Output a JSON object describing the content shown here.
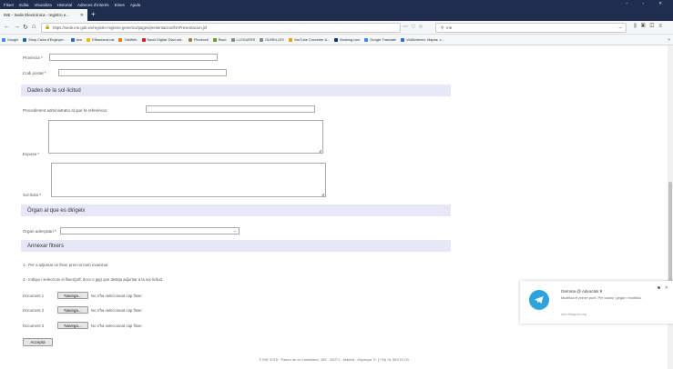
{
  "browser": {
    "menu": [
      "Fitxer",
      "Edita",
      "Visualitza",
      "Historial",
      "Adreces d'interès",
      "Eines",
      "Ajuda"
    ],
    "tab_title": "INE - Sede Electrónica - registro e...",
    "url": "https://sede.ine.gob.es/registro-registro-generico/pages/presentacion/frmPresentacion.jsf",
    "search_value": "ine",
    "bookmarks": [
      {
        "label": "Google",
        "color": "#4285f4"
      },
      {
        "label": "Shop Caixa d'Enginyer...",
        "color": "#1d5fa8"
      },
      {
        "label": "Ave",
        "color": "#1e6fb8"
      },
      {
        "label": "ElNacional.cat",
        "color": "#f2b600"
      },
      {
        "label": "VilaWeb",
        "color": "#e37b14"
      },
      {
        "label": "Nació Digital: Diari cat...",
        "color": "#d02020"
      },
      {
        "label": "Pinoboxit",
        "color": "#a77d3b"
      },
      {
        "label": "Racó",
        "color": "#6a9a2a"
      },
      {
        "label": "LLOGUERS",
        "color": "#888888"
      },
      {
        "label": "OLBRILLES",
        "color": "#888888"
      },
      {
        "label": "YouTube Converter &...",
        "color": "#e8a317"
      },
      {
        "label": "Booking.com",
        "color": "#003580"
      },
      {
        "label": "Google Translate",
        "color": "#4285f4"
      },
      {
        "label": "VidAlchemic: Mapas, c...",
        "color": "#2a6ed8"
      }
    ]
  },
  "form": {
    "provincia_label": "Província",
    "codi_postal_label": "Codi postal",
    "section_dades": "Dades de la sol·licitud",
    "procediment_label": "Procediment administratiu al que fa referència:",
    "exposa_label": "Exposa",
    "sol_licita_label": "Sol·licita",
    "section_organ": "Òrgan al que es dirigeix",
    "organ_label": "Òrgan adreçatari",
    "section_fitxers": "Annexar fitxers",
    "instr1": "1.- Per a adjuntar un fitxer prem el botó examinar.",
    "instr2": "2.- Indiqui i seleccioni el fitxer(pdf, docx o jpg) que desitja adjuntar a la sol·licitud.",
    "documents": [
      {
        "label": "Document 1",
        "button": "Navega...",
        "status": "No s'ha seleccionat cap fitxer."
      },
      {
        "label": "Document 2",
        "button": "Navega...",
        "status": "No s'ha seleccionat cap fitxer."
      },
      {
        "label": "Document 3",
        "button": "Navega...",
        "status": "No s'ha seleccionat cap fitxer."
      }
    ],
    "submit_label": "Accepta"
  },
  "footer": "© INE 2018 · Paseo de la Castellana, 183 - 28071 - Madrid - Espanya Tf. (+34) 91 583 91 00",
  "telegram": {
    "title": "Gemma @ Advocats 9",
    "message": "Modifica el primer punt. Per copiar i pegar l modifica.",
    "link": "web.telegram.org"
  }
}
